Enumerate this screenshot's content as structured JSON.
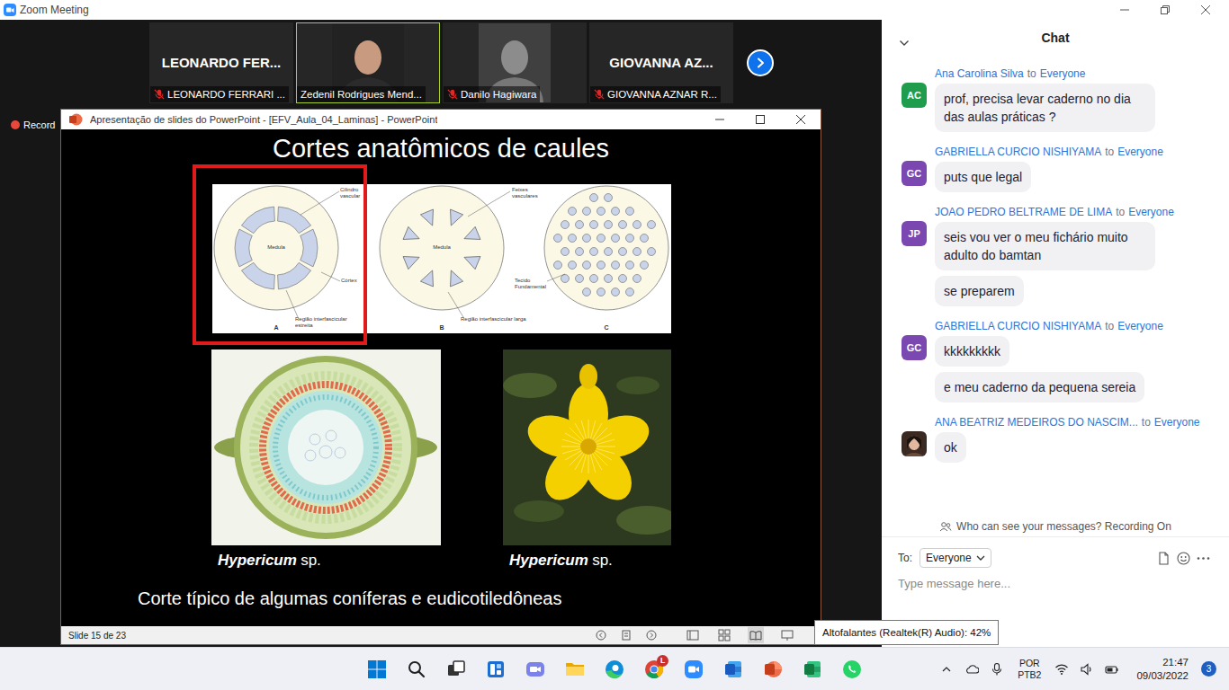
{
  "window": {
    "title": "Zoom Meeting"
  },
  "participants": [
    {
      "display": "LEONARDO FER...",
      "label": "LEONARDO FERRARI ...",
      "kind": "name",
      "muted": true,
      "speaking": false
    },
    {
      "label": "Zedenil Rodrigues Mend...",
      "kind": "video",
      "muted": false,
      "speaking": true
    },
    {
      "label": "Danilo Hagiwara",
      "kind": "video",
      "muted": true,
      "speaking": false
    },
    {
      "display": "GIOVANNA AZ...",
      "label": "GIOVANNA AZNAR R...",
      "kind": "name",
      "muted": true,
      "speaking": false
    }
  ],
  "recording": {
    "label": "Record"
  },
  "presentation": {
    "title": "Apresentação de slides do PowerPoint - [EFV_Aula_04_Laminas] - PowerPoint",
    "slide": {
      "title": "Cortes anatômicos de caules",
      "diagram": {
        "panels": [
          {
            "letter": "A",
            "kind": "ring",
            "highlighted": true,
            "labels": [
              "Cilindro vascular",
              "Medula",
              "Córtex",
              "Região interfascicular estreita"
            ]
          },
          {
            "letter": "B",
            "kind": "bundles",
            "highlighted": false,
            "labels": [
              "Feixes vasculares",
              "Medula",
              "Região interfascicular larga"
            ]
          },
          {
            "letter": "C",
            "kind": "scattered",
            "highlighted": false,
            "labels": [
              "Tecido Fundamental"
            ]
          }
        ]
      },
      "photos": [
        {
          "genus": "Hypericum",
          "suffix": "sp.",
          "kind": "section"
        },
        {
          "genus": "Hypericum",
          "suffix": "sp.",
          "kind": "flower"
        }
      ],
      "footer": "Corte típico de algumas coníferas e eudicotiledôneas"
    },
    "status": "Slide 15 de 23"
  },
  "tooltip": {
    "text": "Altofalantes (Realtek(R) Audio): 42%"
  },
  "chat": {
    "title": "Chat",
    "messages": [
      {
        "sender": "Ana Carolina Silva",
        "to": "to",
        "recipient": "Everyone",
        "avatar": {
          "kind": "initials",
          "initials": "AC",
          "color": "#1f9d4c"
        },
        "bubbles": [
          "prof, precisa levar caderno no dia das aulas práticas ?"
        ]
      },
      {
        "sender": "GABRIELLA CURCIO NISHIYAMA",
        "to": "to",
        "recipient": "Everyone",
        "avatar": {
          "kind": "initials",
          "initials": "GC",
          "color": "#7b47b0"
        },
        "bubbles": [
          "puts que legal"
        ]
      },
      {
        "sender": "JOAO PEDRO BELTRAME DE LIMA",
        "to": "to",
        "recipient": "Everyone",
        "avatar": {
          "kind": "initials",
          "initials": "JP",
          "color": "#7b47b0"
        },
        "bubbles": [
          "seis vou ver o meu fichário muito adulto do bamtan",
          "se preparem"
        ]
      },
      {
        "sender": "GABRIELLA CURCIO NISHIYAMA",
        "to": "to",
        "recipient": "Everyone",
        "avatar": {
          "kind": "initials",
          "initials": "GC",
          "color": "#7b47b0"
        },
        "bubbles": [
          "kkkkkkkkk",
          "e meu caderno da pequena sereia"
        ]
      },
      {
        "sender": "ANA BEATRIZ MEDEIROS DO NASCIM...",
        "to": "to",
        "recipient": "Everyone",
        "avatar": {
          "kind": "photo"
        },
        "bubbles": [
          "ok"
        ]
      }
    ],
    "privacy": "Who can see your messages? Recording On",
    "to_label": "To:",
    "recipient": "Everyone",
    "placeholder": "Type message here..."
  },
  "taskbar": {
    "chrome_badge": "L",
    "language": "POR",
    "layout": "PTB2",
    "time": "21:47",
    "date": "09/03/2022",
    "notifications": "3"
  }
}
